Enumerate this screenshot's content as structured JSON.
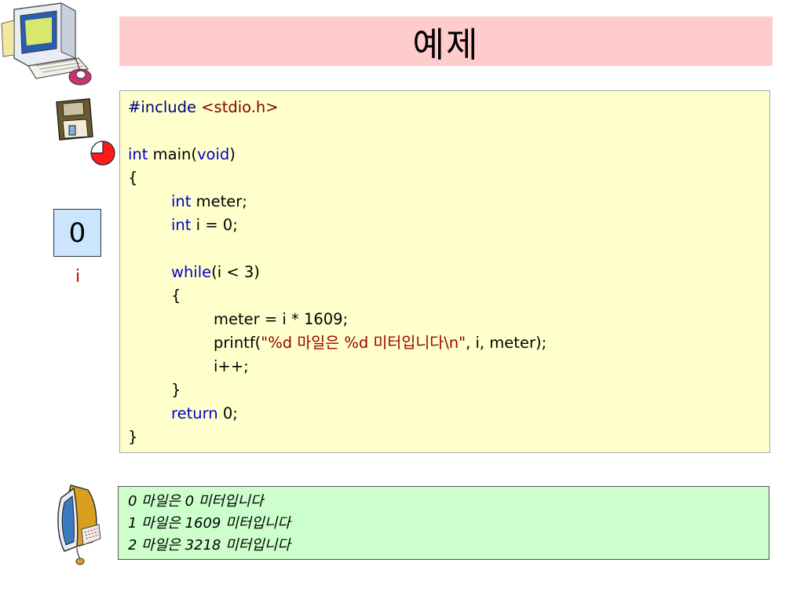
{
  "title": "예제",
  "code": {
    "include_directive": "#include",
    "include_header": "<stdio.h>",
    "kw_int": "int",
    "main_sig": " main(",
    "kw_void": "void",
    "main_close": ")",
    "open_brace": "{",
    "meter_decl": " meter;",
    "i_decl": " i = 0;",
    "kw_while": "while",
    "while_cond": "(i < 3)",
    "inner_open": "{",
    "assign_line": "meter = i * 1609;",
    "printf_start": "printf(",
    "printf_string": "\"%d 마일은 %d 미터입니다\\n\"",
    "printf_end": ", i, meter);",
    "increment": "i++;",
    "inner_close": "}",
    "kw_return": "return",
    "return_value": " 0;",
    "close_brace": "}"
  },
  "variable": {
    "value": "0",
    "name": "i"
  },
  "output_lines": [
    "0 마일은 0 미터입니다",
    "1 마일은 1609 미터입니다",
    "2 마일은 3218 미터입니다"
  ],
  "colors": {
    "title_bg": "#ffcccc",
    "code_bg": "#ffffcc",
    "keyword": "#0000cc",
    "string": "#990000",
    "variable_bg": "#cce5ff",
    "variable_label": "#cc0000",
    "output_bg": "#ccffcc"
  },
  "icons": [
    "computer-clipart-icon",
    "floppy-disk-icon",
    "pie-icon",
    "monitor-clipart-icon"
  ]
}
